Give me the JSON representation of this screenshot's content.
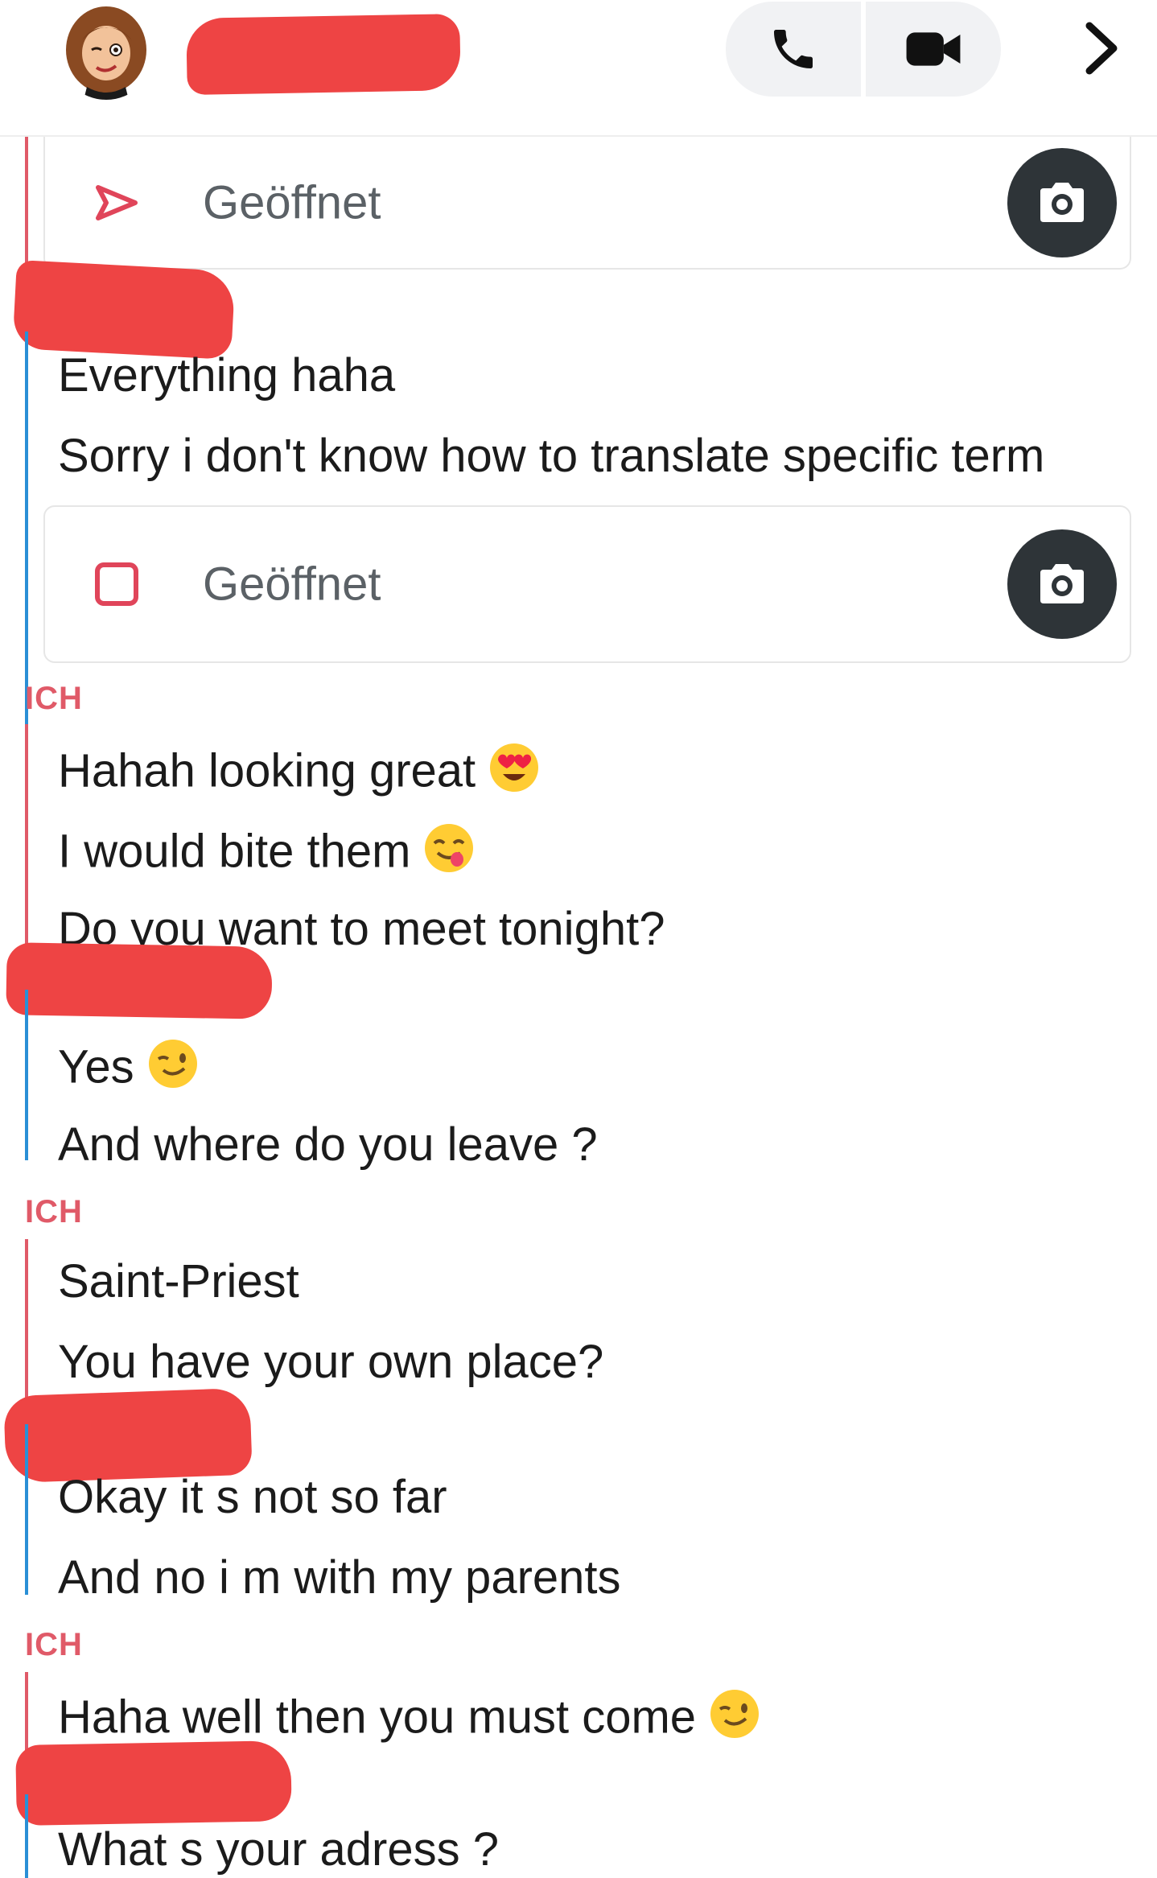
{
  "header": {
    "call_icon": "phone-icon",
    "video_icon": "video-camera-icon",
    "more_icon": "chevron-right-icon"
  },
  "colors": {
    "accent_red": "#e05a68",
    "accent_blue": "#2a8fd6",
    "redaction": "#ee4444",
    "camera_button": "#2e3438"
  },
  "chat": {
    "snap1": {
      "label": "Geöffnet",
      "icon": "sent-arrow-outline-icon"
    },
    "friend_msgs_1": [
      "Everything haha",
      "Sorry i don't know how to translate specific term"
    ],
    "snap2": {
      "label": "Geöffnet",
      "icon": "received-square-outline-icon"
    },
    "me_label_1": "ICH",
    "me_msgs_1": [
      "Hahah looking great",
      "I would bite them",
      "Do you want to meet tonight?"
    ],
    "friend_msgs_2": [
      "Yes",
      "And where do you leave ?"
    ],
    "me_label_2": "ICH",
    "me_msgs_2": [
      "Saint-Priest",
      "You have your own place?"
    ],
    "friend_msgs_3": [
      "Okay it s not so far",
      "And no i m with my parents"
    ],
    "me_label_3": "ICH",
    "me_msgs_3": [
      "Haha well then you must come"
    ],
    "friend_msgs_4": [
      "What s your adress ?"
    ]
  }
}
